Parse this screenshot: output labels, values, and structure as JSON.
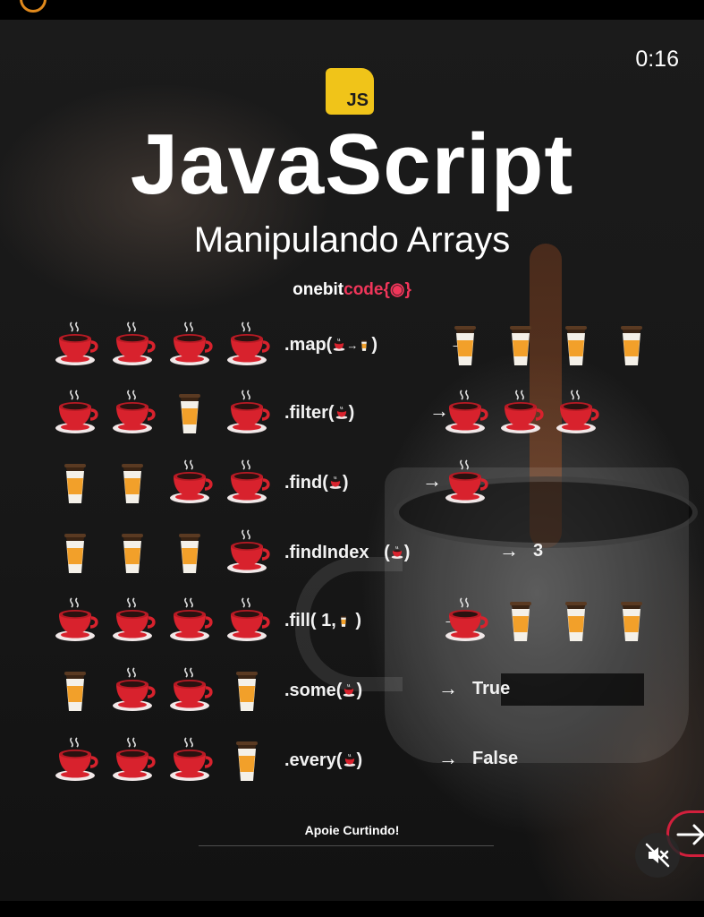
{
  "status": {
    "timer": "0:16"
  },
  "badge": {
    "text": "JS"
  },
  "header": {
    "title": "JavaScript",
    "subtitle": "Manipulando Arrays",
    "brand_white": "onebit",
    "brand_red": "code{",
    "brand_end": "}"
  },
  "rows": [
    {
      "items": [
        "cup",
        "cup",
        "cup",
        "cup"
      ],
      "label": ".map(",
      "label_icons": [
        "cup",
        "arrow",
        "glass"
      ],
      "label_end": ")",
      "results": [
        "glass",
        "glass",
        "glass",
        "glass"
      ],
      "result_text": ""
    },
    {
      "items": [
        "cup",
        "cup",
        "glass",
        "cup"
      ],
      "label": ".filter(",
      "label_icons": [
        "cup"
      ],
      "label_end": ")",
      "results": [
        "cup",
        "cup",
        "cup"
      ],
      "result_text": ""
    },
    {
      "items": [
        "glass",
        "glass",
        "cup",
        "cup"
      ],
      "label": ".find(",
      "label_icons": [
        "cup"
      ],
      "label_end": ")",
      "results": [
        "cup"
      ],
      "result_text": ""
    },
    {
      "items": [
        "glass",
        "glass",
        "glass",
        "cup"
      ],
      "label": ".findIndex   (",
      "label_icons": [
        "cup"
      ],
      "label_end": ")",
      "results": [],
      "result_text": "3"
    },
    {
      "items": [
        "cup",
        "cup",
        "cup",
        "cup"
      ],
      "label": ".fill( 1,",
      "label_icons": [
        "glass"
      ],
      "label_end": " )",
      "results": [
        "cup",
        "glass",
        "glass",
        "glass"
      ],
      "result_text": ""
    },
    {
      "items": [
        "glass",
        "cup",
        "cup",
        "glass"
      ],
      "label": ".some(",
      "label_icons": [
        "cup"
      ],
      "label_end": ")",
      "results": [],
      "result_text": "True"
    },
    {
      "items": [
        "cup",
        "cup",
        "cup",
        "glass"
      ],
      "label": ".every(",
      "label_icons": [
        "cup"
      ],
      "label_end": ")",
      "results": [],
      "result_text": "False"
    }
  ],
  "arrow_glyph": "→",
  "footer": {
    "text": "Apoie Curtindo!"
  },
  "controls": {
    "mute_icon": "speaker-muted-icon",
    "next_icon": "arrow-right-icon",
    "next_glyph": "→"
  },
  "colors": {
    "cup_red": "#d8222d",
    "glass_orange": "#f2a02a",
    "js_yellow": "#f0c419",
    "brand_red": "#f0365a"
  }
}
